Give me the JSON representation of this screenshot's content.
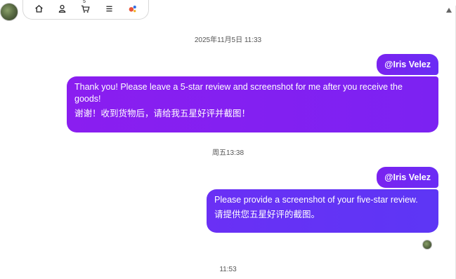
{
  "toolbar": {
    "icons": [
      "home-icon",
      "person-icon",
      "cart-icon",
      "menu-icon",
      "apps-icon"
    ],
    "cart_count": "5"
  },
  "messages": {
    "ts1": "2025年11月5日 11:33",
    "mention1": "@Iris Velez",
    "bubble1_en": "Thank you! Please leave a 5-star review and screenshot for me after you receive the goods!",
    "bubble1_zh": "谢谢！收到货物后，请给我五星好评并截图！",
    "ts2": "周五13:38",
    "mention2": "@Iris Velez",
    "bubble2_en": "Please provide a screenshot of your five-star review.",
    "bubble2_zh": "请提供您五星好评的截图。",
    "ts3": "11:53"
  },
  "colors": {
    "bubble_purple": "#8a1ef0",
    "bubble_violet": "#6a30f5"
  }
}
